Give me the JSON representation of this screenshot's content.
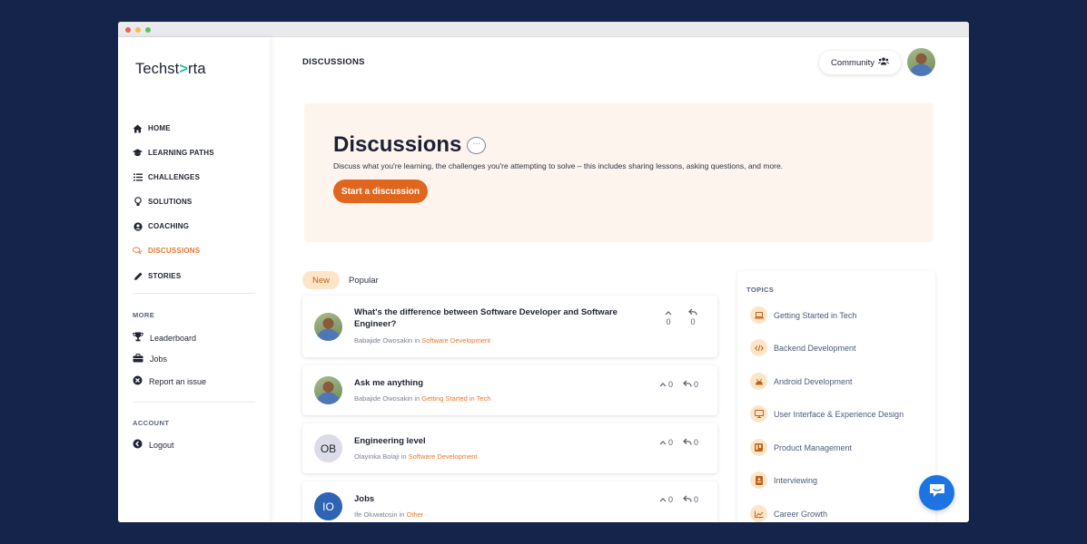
{
  "brand": {
    "logo_prefix": "Techst",
    "logo_accent": ">",
    "logo_suffix": "rta"
  },
  "sidebar": {
    "nav": [
      {
        "label": "HOME",
        "icon": "home-icon"
      },
      {
        "label": "LEARNING PATHS",
        "icon": "graduation-cap-icon"
      },
      {
        "label": "CHALLENGES",
        "icon": "list-icon"
      },
      {
        "label": "SOLUTIONS",
        "icon": "lightbulb-icon"
      },
      {
        "label": "COACHING",
        "icon": "user-circle-icon"
      },
      {
        "label": "DISCUSSIONS",
        "icon": "chat-bubbles-icon",
        "active": true
      },
      {
        "label": "STORIES",
        "icon": "pencil-icon"
      }
    ],
    "more_label": "MORE",
    "more": [
      {
        "label": "Leaderboard",
        "icon": "trophy-icon"
      },
      {
        "label": "Jobs",
        "icon": "briefcase-icon"
      },
      {
        "label": "Report an issue",
        "icon": "x-circle-icon"
      }
    ],
    "account_label": "ACCOUNT",
    "account": [
      {
        "label": "Logout",
        "icon": "arrow-left-circle-icon"
      }
    ]
  },
  "header": {
    "title": "DISCUSSIONS",
    "community_label": "Community"
  },
  "hero": {
    "title": "Discussions",
    "description": "Discuss what you're learning, the challenges you're attempting to solve – this includes sharing lessons, asking questions, and more.",
    "cta": "Start a discussion"
  },
  "tabs": [
    {
      "label": "New",
      "active": true
    },
    {
      "label": "Popular"
    }
  ],
  "discussions": [
    {
      "title": "What's the difference between Software Developer and Software Engineer?",
      "author": "Babajide Owosakin",
      "in": "in",
      "category": "Software Development",
      "upvotes": "0",
      "replies": "0",
      "avatar": "photo"
    },
    {
      "title": "Ask me anything",
      "author": "Babajide Owosakin",
      "in": "in",
      "category": "Getting Started in Tech",
      "upvotes": "0",
      "replies": "0",
      "avatar": "photo"
    },
    {
      "title": "Engineering level",
      "author": "Olayinka Bolaji",
      "in": "in",
      "category": "Software Development",
      "upvotes": "0",
      "replies": "0",
      "initials": "OB",
      "avatar_color": "#dcdce8"
    },
    {
      "title": "Jobs",
      "author": "Ife Oluwatosin",
      "in": "in",
      "category": "Other",
      "upvotes": "0",
      "replies": "0",
      "initials": "IO",
      "avatar_color": "#2f63b4"
    }
  ],
  "topics": {
    "heading": "TOPICS",
    "items": [
      {
        "label": "Getting Started in Tech",
        "icon": "laptop-icon"
      },
      {
        "label": "Backend Development",
        "icon": "code-icon"
      },
      {
        "label": "Android Development",
        "icon": "android-icon"
      },
      {
        "label": "User Interface & Experience Design",
        "icon": "monitor-icon"
      },
      {
        "label": "Product Management",
        "icon": "kanban-icon"
      },
      {
        "label": "Interviewing",
        "icon": "id-card-icon"
      },
      {
        "label": "Career Growth",
        "icon": "chart-line-icon"
      }
    ]
  },
  "colors": {
    "accent": "#e8772e",
    "cta": "#e0661e",
    "background": "#14244a",
    "hero_bg": "#fdf4ee",
    "chat_fab": "#1c74e3"
  }
}
